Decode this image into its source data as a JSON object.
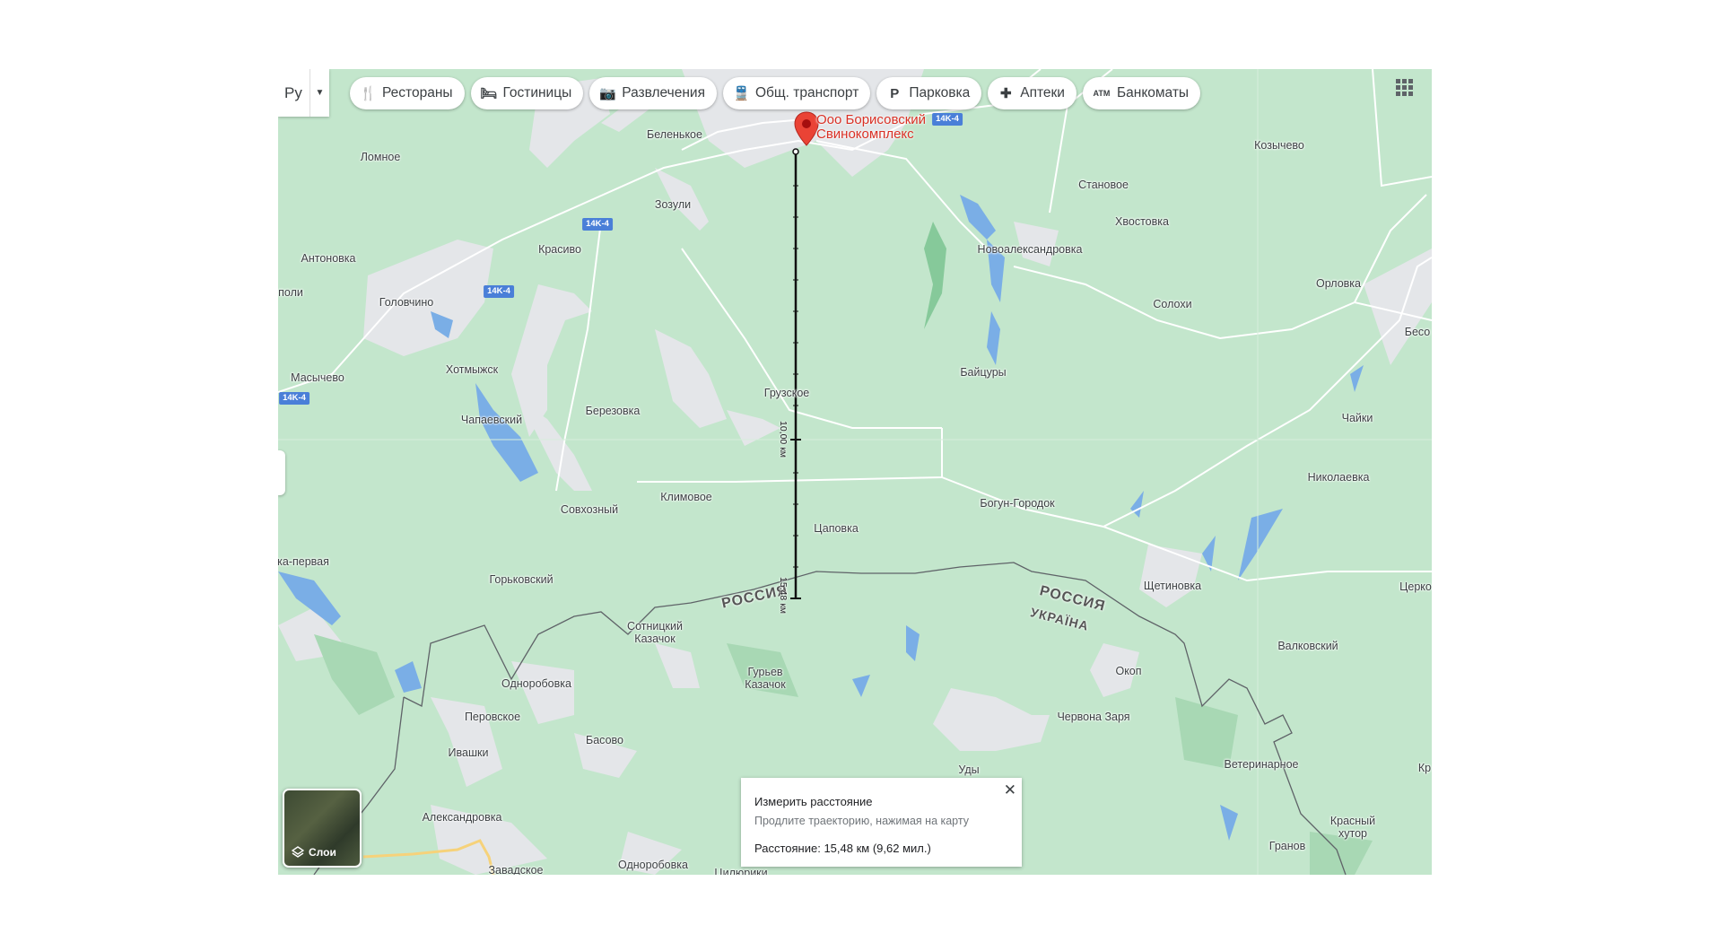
{
  "language_button": {
    "label": "Ру"
  },
  "categories": [
    {
      "icon": "restaurant-icon",
      "glyph": "🍴",
      "label": "Рестораны"
    },
    {
      "icon": "hotel-icon",
      "glyph": "🛏",
      "label": "Гостиницы"
    },
    {
      "icon": "camera-icon",
      "glyph": "📷",
      "label": "Развлечения"
    },
    {
      "icon": "transit-icon",
      "glyph": "🚆",
      "label": "Общ. транспорт"
    },
    {
      "icon": "parking-icon",
      "glyph": "P",
      "label": "Парковка"
    },
    {
      "icon": "pharmacy-icon",
      "glyph": "✚",
      "label": "Аптеки"
    },
    {
      "icon": "atm-icon",
      "glyph": "ATM",
      "label": "Банкоматы"
    }
  ],
  "marker": {
    "name_line1": "Ооо Борисовский",
    "name_line2": "Свинокомплекс",
    "color": "#ea4335"
  },
  "places": [
    "Беленькое",
    "Ломное",
    "Зозули",
    "Красиво",
    "Антоновка",
    "поли",
    "Головчино",
    "Масычево",
    "Хотмыжск",
    "Чапаевский",
    "Березовка",
    "Грузское",
    "Климовое",
    "Совхозный",
    "Цаповка",
    "ка-первая",
    "Горьковский",
    "Сотницкий",
    "Казачок",
    "Одноробовка",
    "Гурьев",
    "Казачок",
    "Перовское",
    "Ивашки",
    "Басово",
    "Александровка",
    "Одноробовка",
    "Завадское",
    "Цилюрики",
    "Уды",
    "Червона Заря",
    "Окоп",
    "Валковский",
    "Ветеринарное",
    "Красный",
    "хутор",
    "Гранов",
    "Кр",
    "Церко",
    "Щетиновка",
    "Николаевка",
    "Чайки",
    "Богун-Городок",
    "Байцуры",
    "Бесо",
    "Орловка",
    "Солохи",
    "Новоалександровка",
    "Хвостовка",
    "Становое",
    "Козычево"
  ],
  "road_shields": [
    "14K-4",
    "14K-4",
    "14K-4",
    "14K-4"
  ],
  "border_labels": {
    "russia_1": "РОССИЯ",
    "russia_2": "РОССИЯ",
    "ukraine": "УКРАЇНА"
  },
  "distance_labels": {
    "mid": "10,00 км",
    "end": "15,48 км"
  },
  "layers": {
    "label": "Слои"
  },
  "measure": {
    "title": "Измерить расстояние",
    "hint": "Продлите траекторию, нажимая на карту",
    "distance": "Расстояние: 15,48 км (9,62 мил.)"
  },
  "colors": {
    "land": "#c3e6cc",
    "urban": "#e8eaed",
    "water": "#6fa3e0",
    "forest": "#8fd1a2",
    "border": "#5f6368",
    "chip_text": "#3c4043"
  }
}
